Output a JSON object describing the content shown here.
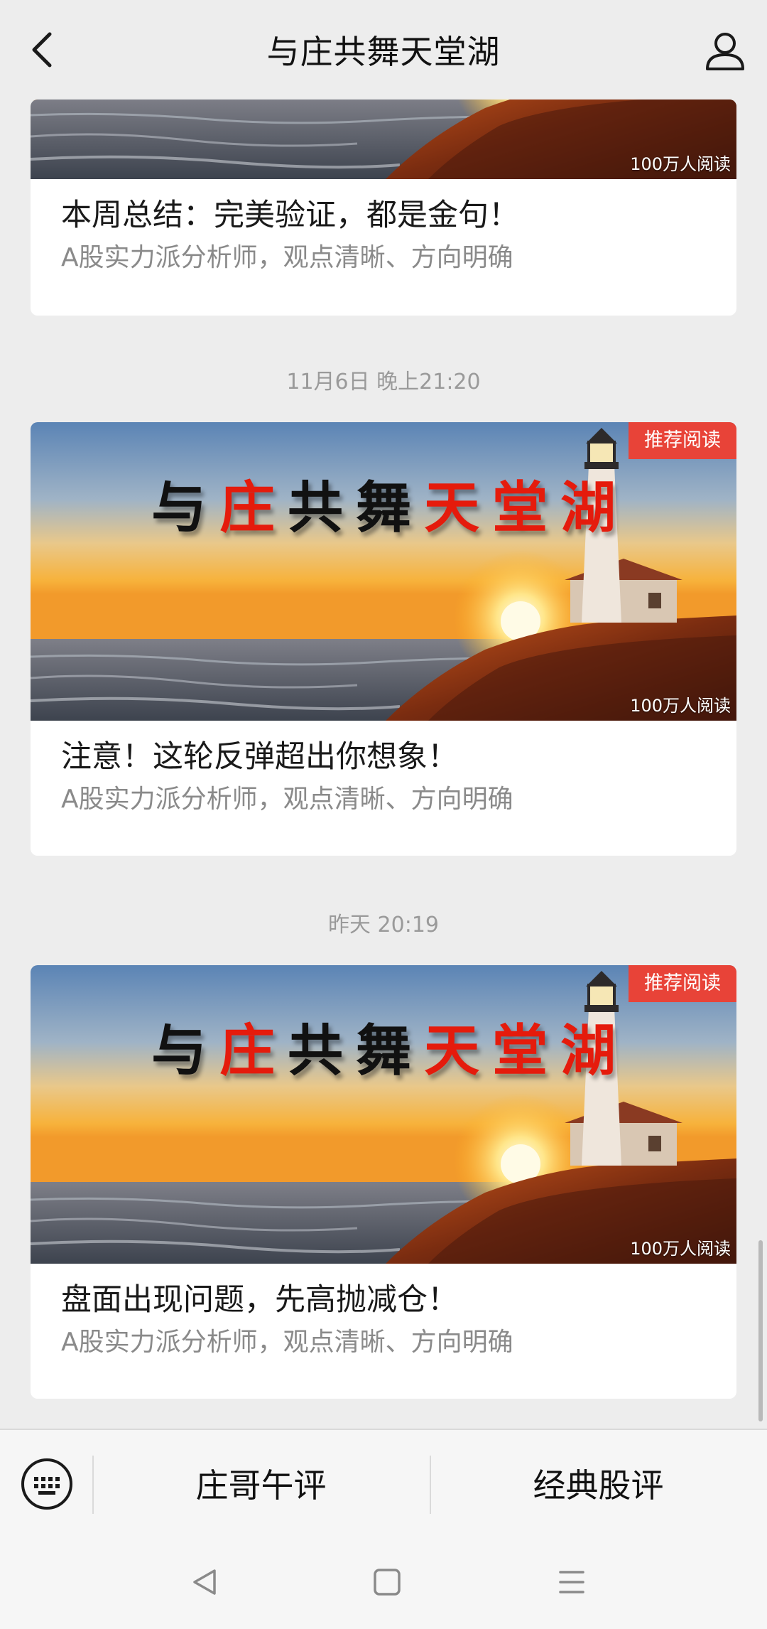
{
  "header": {
    "title": "与庄共舞天堂湖",
    "back_icon": "chevron-left-icon",
    "profile_icon": "user-icon"
  },
  "banner": {
    "chars": [
      {
        "t": "与",
        "color": "black"
      },
      {
        "t": "庄",
        "color": "red"
      },
      {
        "t": "共",
        "color": "black"
      },
      {
        "t": "舞",
        "color": "black"
      },
      {
        "t": "天",
        "color": "red"
      },
      {
        "t": "堂",
        "color": "red"
      },
      {
        "t": "湖",
        "color": "red"
      }
    ]
  },
  "articles": [
    {
      "time": "",
      "title": "本周总结：完美验证，都是金句！",
      "subtitle": "A股实力派分析师，观点清晰、方向明确",
      "reads": "100万人阅读",
      "badge": ""
    },
    {
      "time": "11月6日 晚上21:20",
      "title": "注意！这轮反弹超出你想象！",
      "subtitle": "A股实力派分析师，观点清晰、方向明确",
      "reads": "100万人阅读",
      "badge": "推荐阅读"
    },
    {
      "time": "昨天 20:19",
      "title": "盘面出现问题，先高抛减仓！",
      "subtitle": "A股实力派分析师，观点清晰、方向明确",
      "reads": "100万人阅读",
      "badge": "推荐阅读"
    }
  ],
  "bottom_menu": {
    "keyboard_icon": "keyboard-icon",
    "items": [
      "庄哥午评",
      "经典股评"
    ]
  },
  "navbar": {
    "back_icon": "triangle-back-icon",
    "home_icon": "square-home-icon",
    "menu_icon": "menu-lines-icon"
  },
  "colors": {
    "badge_red": "#e84338",
    "banner_red": "#e51b0c",
    "background": "#ededed"
  }
}
